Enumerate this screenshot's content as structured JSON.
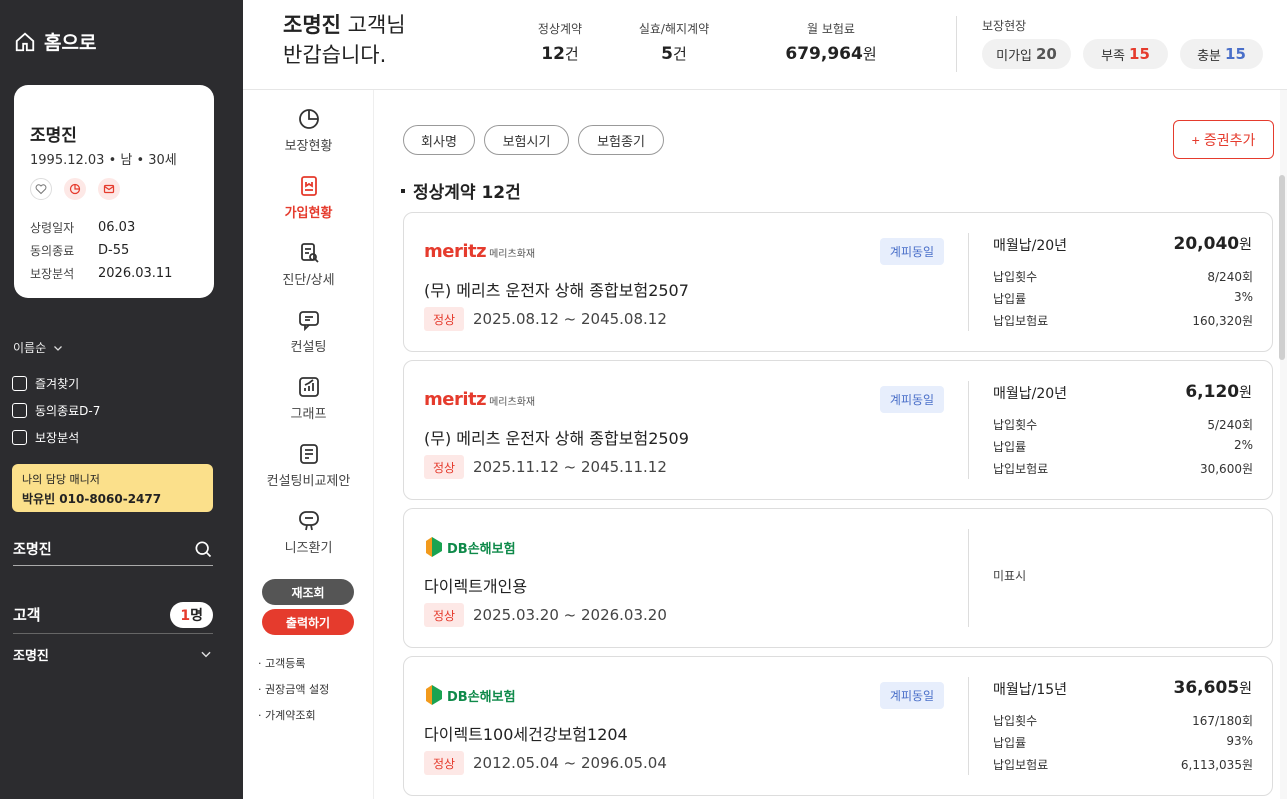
{
  "sidebar": {
    "home_label": "홈으로",
    "profile": {
      "name": "조명진",
      "sub": "1995.12.03 • 남 • 30세",
      "info": [
        {
          "label": "상령일자",
          "value": "06.03"
        },
        {
          "label": "동의종료",
          "value": "D-55"
        },
        {
          "label": "보장분석",
          "value": "2026.03.11"
        }
      ]
    },
    "sort_label": "이름순",
    "checks": [
      "즐겨찾기",
      "동의종료D-7",
      "보장분석"
    ],
    "manager": {
      "title": "나의 담당 매니저",
      "contact": "박유빈 010-8060-2477"
    },
    "search_value": "조명진",
    "customer_label": "고객",
    "customer_count": "1",
    "customer_count_unit": "명",
    "customer_item": "조명진"
  },
  "header": {
    "greeting_name": "조명진",
    "greeting_suffix": " 고객님",
    "greeting_line2": "반갑습니다.",
    "stats": [
      {
        "label": "정상계약",
        "value": "12",
        "unit": "건"
      },
      {
        "label": "실효/해지계약",
        "value": "5",
        "unit": "건"
      },
      {
        "label": "월 보험료",
        "value": "679,964",
        "unit": "원"
      }
    ],
    "coverage_label": "보장현장",
    "coverage": [
      {
        "label": "미가입",
        "value": "20",
        "color": "#555555"
      },
      {
        "label": "부족",
        "value": "15",
        "color": "#e53b2d"
      },
      {
        "label": "충분",
        "value": "15",
        "color": "#4a6fc9"
      }
    ]
  },
  "nav": {
    "items": [
      "보장현황",
      "가입현황",
      "진단/상세",
      "컨설팅",
      "그래프",
      "컨설팅비교제안",
      "니즈환기"
    ],
    "reload": "재조회",
    "print": "출력하기",
    "links": [
      "· 고객등록",
      "· 권장금액 설정",
      "· 가계약조회"
    ]
  },
  "main": {
    "filters": [
      "회사명",
      "보험시기",
      "보험종기"
    ],
    "add_label": "증권추가",
    "section_title": "정상계약 12건",
    "cards": [
      {
        "company": "meritz",
        "company_sub": "메리츠화재",
        "consent": "계피동일",
        "name": "(무) 메리츠 운전자 상해 종합보험2507",
        "status": "정상",
        "period": "2025.08.12 ~ 2045.08.12",
        "pay_head": "매월납/20년",
        "pay_amt": "20,040",
        "rows": [
          {
            "label": "납입횟수",
            "value": "8/240회"
          },
          {
            "label": "납입률",
            "value": "3%"
          },
          {
            "label": "납입보험료",
            "value": "160,320원"
          }
        ]
      },
      {
        "company": "meritz",
        "company_sub": "메리츠화재",
        "consent": "계피동일",
        "name": "(무) 메리츠 운전자 상해 종합보험2509",
        "status": "정상",
        "period": "2025.11.12 ~ 2045.11.12",
        "pay_head": "매월납/20년",
        "pay_amt": "6,120",
        "rows": [
          {
            "label": "납입횟수",
            "value": "5/240회"
          },
          {
            "label": "납입률",
            "value": "2%"
          },
          {
            "label": "납입보험료",
            "value": "30,600원"
          }
        ]
      },
      {
        "company": "DB손해보험",
        "name": "다이렉트개인용",
        "status": "정상",
        "period": "2025.03.20 ~ 2026.03.20",
        "unmarked": "미표시"
      },
      {
        "company": "DB손해보험",
        "consent": "계피동일",
        "name": "다이렉트100세건강보험1204",
        "status": "정상",
        "period": "2012.05.04 ~ 2096.05.04",
        "pay_head": "매월납/15년",
        "pay_amt": "36,605",
        "rows": [
          {
            "label": "납입횟수",
            "value": "167/180회"
          },
          {
            "label": "납입률",
            "value": "93%"
          },
          {
            "label": "납입보험료",
            "value": "6,113,035원"
          }
        ]
      }
    ],
    "currency_unit": "원"
  }
}
